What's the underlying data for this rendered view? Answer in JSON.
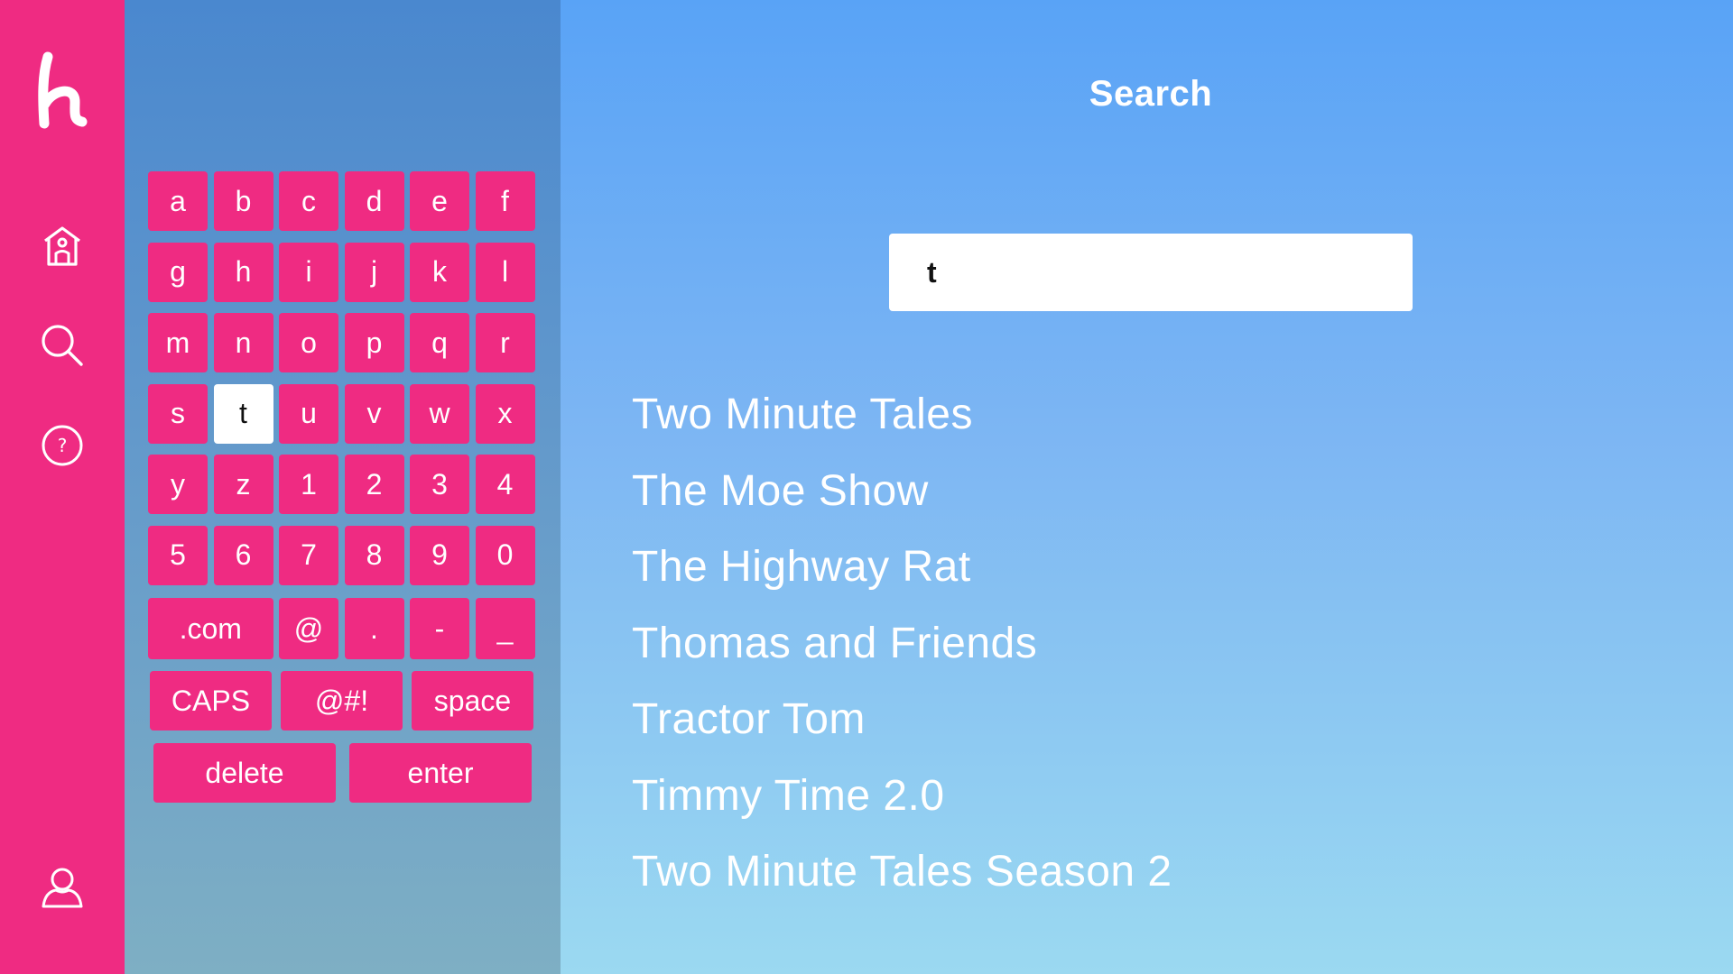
{
  "sidebar": {
    "items": [
      {
        "name": "home",
        "icon": "home-icon"
      },
      {
        "name": "search",
        "icon": "search-icon"
      },
      {
        "name": "help",
        "icon": "help-icon"
      },
      {
        "name": "profile",
        "icon": "profile-icon"
      }
    ],
    "logo": "h"
  },
  "keyboard": {
    "selected": "t",
    "rows": [
      [
        "a",
        "b",
        "c",
        "d",
        "e",
        "f"
      ],
      [
        "g",
        "h",
        "i",
        "j",
        "k",
        "l"
      ],
      [
        "m",
        "n",
        "o",
        "p",
        "q",
        "r"
      ],
      [
        "s",
        "t",
        "u",
        "v",
        "w",
        "x"
      ],
      [
        "y",
        "z",
        "1",
        "2",
        "3",
        "4"
      ],
      [
        "5",
        "6",
        "7",
        "8",
        "9",
        "0"
      ]
    ],
    "special_row": [
      ".com",
      "@",
      ".",
      "-",
      "_"
    ],
    "mode_row": [
      "CAPS",
      "@#!",
      "space"
    ],
    "action_row": [
      "delete",
      "enter"
    ]
  },
  "main": {
    "title": "Search",
    "search_value": "t",
    "results": [
      "Two Minute Tales",
      "The Moe Show",
      "The Highway Rat",
      "Thomas and Friends",
      "Tractor Tom",
      "Timmy Time 2.0",
      "Two Minute Tales Season 2"
    ]
  },
  "colors": {
    "brand_pink": "#ef2b82",
    "text_white": "#ffffff"
  }
}
